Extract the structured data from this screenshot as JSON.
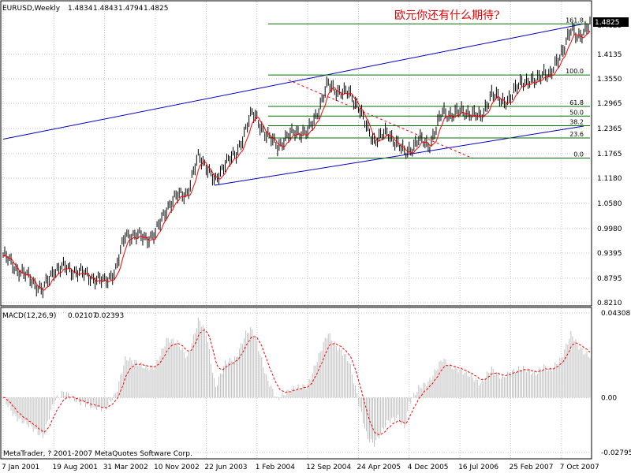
{
  "chart_header": {
    "symbol": "EURUSD,Weekly",
    "ohlc": [
      "1.4834",
      "1.4843",
      "1.4794",
      "1.4825"
    ]
  },
  "annotation": "欧元你还有什么期待?",
  "macd_header": {
    "name": "MACD(12,26,9)",
    "values": [
      "0.02107",
      "0.02393"
    ]
  },
  "footer_text": "MetaTrader, ? 2001-2007 MetaQuotes Software Corp.",
  "current_price_label": "1.4825",
  "colors": {
    "background": "#ffffff",
    "grid": "#c0c0c0",
    "candles": "#000000",
    "moving_average": "#ff0000",
    "channel": "#0000c0",
    "fibonacci": "#007000",
    "dashed_trend": "#ff0000",
    "macd_histogram": "#c0c0c0",
    "macd_signal": "#ff0000",
    "annotation": "#e00000"
  },
  "chart_data": [
    {
      "type": "candlestick",
      "title": "",
      "series_name": "EURUSD,Weekly",
      "x_tick_labels": [
        "7 Jan 2001",
        "19 Aug 2001",
        "31 Mar 2002",
        "10 Nov 2002",
        "22 Jun 2003",
        "1 Feb 2004",
        "12 Sep 2004",
        "24 Apr 2005",
        "4 Dec 2005",
        "16 Jul 2006",
        "25 Feb 2007",
        "7 Oct 2007"
      ],
      "y_tick_labels": [
        "1.4825",
        "1.4135",
        "1.3550",
        "1.2965",
        "1.2365",
        "1.1765",
        "1.1180",
        "1.0580",
        "0.9980",
        "0.9395",
        "0.8795",
        "0.8210"
      ],
      "ylim": [
        0.821,
        1.494
      ],
      "grid": true,
      "price_points": [
        [
          "2001-01-07",
          0.935
        ],
        [
          "2001-03-01",
          0.905
        ],
        [
          "2001-05-01",
          0.88
        ],
        [
          "2001-07-01",
          0.85
        ],
        [
          "2001-08-19",
          0.9
        ],
        [
          "2001-10-01",
          0.905
        ],
        [
          "2001-12-01",
          0.895
        ],
        [
          "2002-01-20",
          0.885
        ],
        [
          "2002-03-31",
          0.87
        ],
        [
          "2002-05-20",
          0.9
        ],
        [
          "2002-07-01",
          0.985
        ],
        [
          "2002-08-20",
          0.98
        ],
        [
          "2002-10-01",
          0.975
        ],
        [
          "2002-11-10",
          0.985
        ],
        [
          "2003-01-01",
          1.05
        ],
        [
          "2003-02-15",
          1.075
        ],
        [
          "2003-04-01",
          1.085
        ],
        [
          "2003-05-20",
          1.17
        ],
        [
          "2003-06-22",
          1.15
        ],
        [
          "2003-08-01",
          1.105
        ],
        [
          "2003-09-15",
          1.16
        ],
        [
          "2003-11-01",
          1.17
        ],
        [
          "2003-12-15",
          1.24
        ],
        [
          "2004-01-10",
          1.27
        ],
        [
          "2004-02-01",
          1.26
        ],
        [
          "2004-03-15",
          1.22
        ],
        [
          "2004-05-01",
          1.195
        ],
        [
          "2004-06-15",
          1.215
        ],
        [
          "2004-07-20",
          1.23
        ],
        [
          "2004-09-12",
          1.225
        ],
        [
          "2004-10-20",
          1.27
        ],
        [
          "2004-12-10",
          1.34
        ],
        [
          "2005-01-10",
          1.33
        ],
        [
          "2005-02-20",
          1.32
        ],
        [
          "2005-03-15",
          1.32
        ],
        [
          "2005-04-24",
          1.29
        ],
        [
          "2005-06-01",
          1.235
        ],
        [
          "2005-07-01",
          1.21
        ],
        [
          "2005-09-01",
          1.225
        ],
        [
          "2005-10-15",
          1.2
        ],
        [
          "2005-11-15",
          1.175
        ],
        [
          "2005-12-04",
          1.185
        ],
        [
          "2006-01-15",
          1.21
        ],
        [
          "2006-03-01",
          1.195
        ],
        [
          "2006-05-01",
          1.275
        ],
        [
          "2006-06-01",
          1.27
        ],
        [
          "2006-07-16",
          1.275
        ],
        [
          "2006-09-01",
          1.275
        ],
        [
          "2006-10-15",
          1.26
        ],
        [
          "2006-12-01",
          1.32
        ],
        [
          "2007-01-15",
          1.3
        ],
        [
          "2007-02-25",
          1.31
        ],
        [
          "2007-04-15",
          1.35
        ],
        [
          "2007-05-15",
          1.35
        ],
        [
          "2007-06-15",
          1.345
        ],
        [
          "2007-07-20",
          1.375
        ],
        [
          "2007-08-20",
          1.36
        ],
        [
          "2007-10-07",
          1.42
        ],
        [
          "2007-11-20",
          1.47
        ],
        [
          "2007-12-15",
          1.455
        ],
        [
          "2008-01-15",
          1.47
        ],
        [
          "2008-02-10",
          1.4825
        ]
      ]
    },
    {
      "type": "bar",
      "title": "",
      "series_name": "MACD(12,26,9)",
      "y_tick_labels": [
        "0.04308",
        "0.00",
        "-0.02795"
      ],
      "ylim": [
        -0.02795,
        0.04308
      ],
      "histogram_points": [
        [
          "2001-01-07",
          0.0
        ],
        [
          "2001-03-01",
          -0.01
        ],
        [
          "2001-05-01",
          -0.014
        ],
        [
          "2001-07-01",
          -0.02
        ],
        [
          "2001-08-19",
          -0.002
        ],
        [
          "2001-10-01",
          0.003
        ],
        [
          "2001-12-01",
          -0.002
        ],
        [
          "2002-01-20",
          -0.004
        ],
        [
          "2002-03-31",
          -0.006
        ],
        [
          "2002-05-20",
          0.002
        ],
        [
          "2002-07-01",
          0.02
        ],
        [
          "2002-08-20",
          0.018
        ],
        [
          "2002-10-01",
          0.015
        ],
        [
          "2002-11-10",
          0.016
        ],
        [
          "2003-01-01",
          0.03
        ],
        [
          "2003-02-15",
          0.028
        ],
        [
          "2003-04-01",
          0.02
        ],
        [
          "2003-05-20",
          0.04
        ],
        [
          "2003-06-22",
          0.033
        ],
        [
          "2003-08-01",
          0.005
        ],
        [
          "2003-09-15",
          0.018
        ],
        [
          "2003-11-01",
          0.02
        ],
        [
          "2003-12-15",
          0.033
        ],
        [
          "2004-01-10",
          0.035
        ],
        [
          "2004-02-01",
          0.028
        ],
        [
          "2004-03-15",
          0.01
        ],
        [
          "2004-05-01",
          -0.001
        ],
        [
          "2004-06-15",
          0.003
        ],
        [
          "2004-07-20",
          0.005
        ],
        [
          "2004-09-12",
          0.006
        ],
        [
          "2004-10-20",
          0.018
        ],
        [
          "2004-12-10",
          0.033
        ],
        [
          "2005-01-10",
          0.027
        ],
        [
          "2005-02-20",
          0.022
        ],
        [
          "2005-03-15",
          0.018
        ],
        [
          "2005-04-24",
          -0.002
        ],
        [
          "2005-06-01",
          -0.02
        ],
        [
          "2005-07-01",
          -0.024
        ],
        [
          "2005-09-01",
          -0.012
        ],
        [
          "2005-10-15",
          -0.01
        ],
        [
          "2005-11-15",
          -0.016
        ],
        [
          "2005-12-04",
          -0.003
        ],
        [
          "2006-01-15",
          0.005
        ],
        [
          "2006-03-01",
          0.008
        ],
        [
          "2006-05-01",
          0.02
        ],
        [
          "2006-06-01",
          0.016
        ],
        [
          "2006-07-16",
          0.014
        ],
        [
          "2006-09-01",
          0.011
        ],
        [
          "2006-10-15",
          0.007
        ],
        [
          "2006-12-01",
          0.015
        ],
        [
          "2007-01-15",
          0.01
        ],
        [
          "2007-02-25",
          0.013
        ],
        [
          "2007-04-15",
          0.015
        ],
        [
          "2007-05-15",
          0.014
        ],
        [
          "2007-06-15",
          0.012
        ],
        [
          "2007-07-20",
          0.016
        ],
        [
          "2007-08-20",
          0.014
        ],
        [
          "2007-10-07",
          0.02
        ],
        [
          "2007-11-20",
          0.033
        ],
        [
          "2007-12-15",
          0.027
        ],
        [
          "2008-01-15",
          0.023
        ],
        [
          "2008-02-10",
          0.021
        ]
      ]
    }
  ],
  "fibonacci_levels": [
    "161.8",
    "100.0",
    "61.8",
    "50.0",
    "38.2",
    "23.6",
    "0.0"
  ]
}
